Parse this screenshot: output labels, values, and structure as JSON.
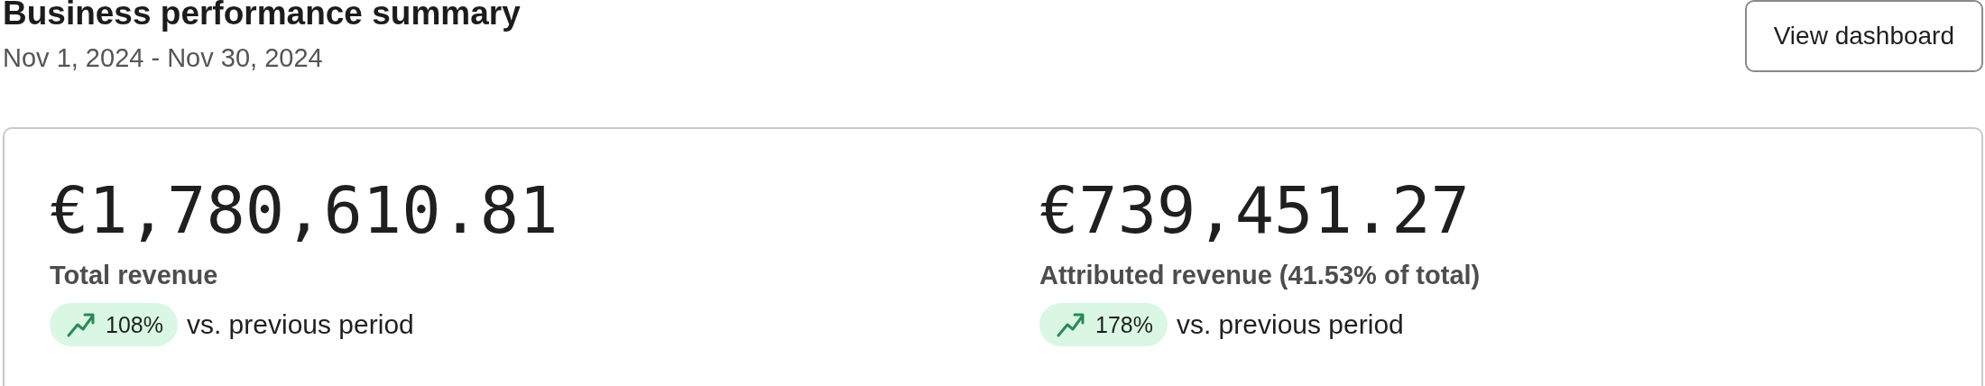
{
  "header": {
    "title": "Business performance summary",
    "date_range": "Nov 1, 2024 - Nov 30, 2024",
    "button": "View dashboard"
  },
  "metrics": [
    {
      "value": "€1,780,610.81",
      "label": "Total revenue",
      "change": "108%",
      "up": true,
      "comparison": "vs. previous period"
    },
    {
      "value": "€739,451.27",
      "label": "Attributed revenue (41.53% of total)",
      "change": "178%",
      "up": true,
      "comparison": "vs. previous period"
    }
  ]
}
